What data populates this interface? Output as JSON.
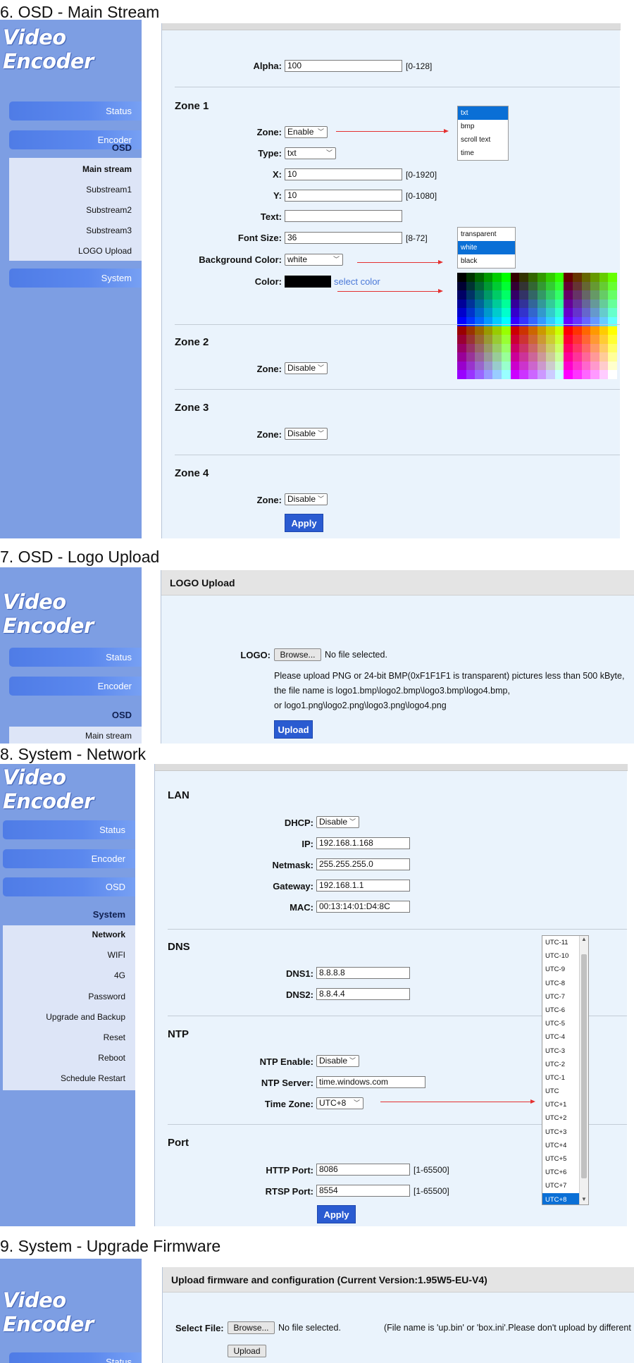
{
  "sections": {
    "s6": "6.  OSD - Main Stream",
    "s7": "7.  OSD - Logo Upload",
    "s8": "8.  System - Network",
    "s9": "9.  System - Upgrade Firmware"
  },
  "brand": "Video Encoder",
  "menu": {
    "status": "Status",
    "encoder": "Encoder",
    "osd": "OSD",
    "system": "System",
    "osd_items": [
      "Main stream",
      "Substream1",
      "Substream2",
      "Substream3",
      "LOGO Upload"
    ],
    "system_items": [
      "Network",
      "WIFI",
      "4G",
      "Password",
      "Upgrade and Backup",
      "Reset",
      "Reboot",
      "Schedule Restart"
    ]
  },
  "osd_main": {
    "alpha_label": "Alpha:",
    "alpha_value": "100",
    "alpha_range": "[0-128]",
    "zone1_title": "Zone 1",
    "zone_label": "Zone:",
    "zone1_value": "Enable",
    "type_label": "Type:",
    "type_value": "txt",
    "x_label": "X:",
    "x_value": "10",
    "x_range": "[0-1920]",
    "y_label": "Y:",
    "y_value": "10",
    "y_range": "[0-1080]",
    "text_label": "Text:",
    "text_value": "",
    "fontsize_label": "Font Size:",
    "fontsize_value": "36",
    "fontsize_range": "[8-72]",
    "bgcolor_label": "Background Color:",
    "bgcolor_value": "white",
    "color_label": "Color:",
    "select_color": "select color",
    "zone2_title": "Zone 2",
    "zone2_value": "Disable",
    "zone3_title": "Zone 3",
    "zone3_value": "Disable",
    "zone4_title": "Zone 4",
    "zone4_value": "Disable",
    "apply": "Apply",
    "type_options": [
      "txt",
      "bmp",
      "scroll text",
      "time"
    ],
    "bg_options": [
      "transparent",
      "white",
      "black"
    ]
  },
  "logo_upload": {
    "header": "LOGO Upload",
    "logo_label": "LOGO:",
    "browse": "Browse...",
    "no_file": "No file selected.",
    "note1": "Please upload PNG or 24-bit BMP(0xF1F1F1 is transparent) pictures less than 500 kByte,",
    "note2": "the file name is logo1.bmp\\logo2.bmp\\logo3.bmp\\logo4.bmp,",
    "note3": "or logo1.png\\logo2.png\\logo3.png\\logo4.png",
    "upload": "Upload"
  },
  "network": {
    "lan_title": "LAN",
    "dhcp_label": "DHCP:",
    "dhcp_value": "Disable",
    "ip_label": "IP:",
    "ip_value": "192.168.1.168",
    "netmask_label": "Netmask:",
    "netmask_value": "255.255.255.0",
    "gateway_label": "Gateway:",
    "gateway_value": "192.168.1.1",
    "mac_label": "MAC:",
    "mac_value": "00:13:14:01:D4:8C",
    "dns_title": "DNS",
    "dns1_label": "DNS1:",
    "dns1_value": "8.8.8.8",
    "dns2_label": "DNS2:",
    "dns2_value": "8.8.4.4",
    "ntp_title": "NTP",
    "ntp_enable_label": "NTP Enable:",
    "ntp_enable_value": "Disable",
    "ntp_server_label": "NTP Server:",
    "ntp_server_value": "time.windows.com",
    "tz_label": "Time Zone:",
    "tz_value": "UTC+8",
    "port_title": "Port",
    "http_label": "HTTP Port:",
    "http_value": "8086",
    "http_range": "[1-65500]",
    "rtsp_label": "RTSP Port:",
    "rtsp_value": "8554",
    "rtsp_range": "[1-65500]",
    "apply": "Apply",
    "tz_options": [
      "UTC-11",
      "UTC-10",
      "UTC-9",
      "UTC-8",
      "UTC-7",
      "UTC-6",
      "UTC-5",
      "UTC-4",
      "UTC-3",
      "UTC-2",
      "UTC-1",
      "UTC",
      "UTC+1",
      "UTC+2",
      "UTC+3",
      "UTC+4",
      "UTC+5",
      "UTC+6",
      "UTC+7",
      "UTC+8"
    ]
  },
  "upgrade": {
    "header": "Upload firmware and configuration (Current Version:1.95W5-EU-V4)",
    "select_label": "Select File:",
    "browse": "Browse...",
    "no_file": "No file selected.",
    "note": "(File name is 'up.bin' or 'box.ini'.Please don't upload by different",
    "upload": "Upload"
  }
}
